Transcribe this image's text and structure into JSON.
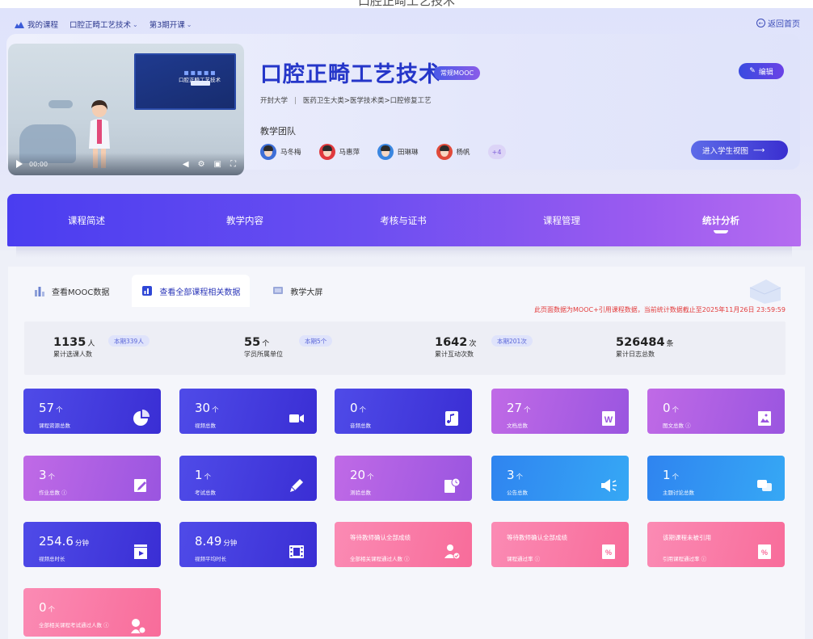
{
  "breadcrumb": {
    "my_courses": "我的课程",
    "course": "口腔正畸工艺技术",
    "term": "第3期开课"
  },
  "back_home": "返回首页",
  "video": {
    "screen_title_1": "■ ■ ■ ■ ■",
    "screen_title_2": "口腔正畸工艺技术",
    "time": "00:00"
  },
  "course": {
    "title": "口腔正畸工艺技术",
    "badge": "常规MOOC",
    "school": "开封大学",
    "category_path": "医药卫生大类>医学技术类>口腔修复工艺",
    "team_title": "教学团队",
    "team": [
      {
        "name": "马冬梅",
        "avatar_color": "#3e6fd8"
      },
      {
        "name": "马惠萍",
        "avatar_color": "#e0393e"
      },
      {
        "name": "田琳琳",
        "avatar_color": "#3a86e0"
      },
      {
        "name": "杨帆",
        "avatar_color": "#e04a3a"
      }
    ],
    "more_count": "+4"
  },
  "buttons": {
    "edit": "编辑",
    "student_view": "进入学生视图"
  },
  "nav_tabs": [
    {
      "label": "课程简述",
      "active": false
    },
    {
      "label": "教学内容",
      "active": false
    },
    {
      "label": "考核与证书",
      "active": false
    },
    {
      "label": "课程管理",
      "active": false
    },
    {
      "label": "统计分析",
      "active": true
    }
  ],
  "sub_tabs": [
    {
      "label": "查看MOOC数据",
      "active": false
    },
    {
      "label": "查看全部课程相关数据",
      "active": true
    },
    {
      "label": "教学大屏",
      "active": false
    }
  ],
  "notice": "此页面数据为MOOC+引用课程数据，当前统计数据截止至2025年11月26日 23:59:59",
  "summary": [
    {
      "value": "1135",
      "unit": "人",
      "label": "累计选课人数",
      "tag": "本期339人"
    },
    {
      "value": "55",
      "unit": "个",
      "label": "学员所属单位",
      "tag": "本期5个"
    },
    {
      "value": "1642",
      "unit": "次",
      "label": "累计互动次数",
      "tag": "本期201次"
    },
    {
      "value": "526484",
      "unit": "条",
      "label": "累计日志总数",
      "tag": ""
    }
  ],
  "cards": [
    {
      "value": "57",
      "unit": "个",
      "label": "课程资源总数",
      "icon": "pie-chart-icon"
    },
    {
      "value": "30",
      "unit": "个",
      "label": "视频总数",
      "icon": "video-camera-icon"
    },
    {
      "value": "0",
      "unit": "个",
      "label": "音频总数",
      "icon": "music-note-icon"
    },
    {
      "value": "27",
      "unit": "个",
      "label": "文档总数",
      "icon": "word-document-icon"
    },
    {
      "value": "0",
      "unit": "个",
      "label": "图文总数 ⓘ",
      "icon": "image-document-icon"
    },
    {
      "value": "3",
      "unit": "个",
      "label": "作业总数 ⓘ",
      "icon": "homework-edit-icon"
    },
    {
      "value": "1",
      "unit": "个",
      "label": "考试总数",
      "icon": "pen-icon"
    },
    {
      "value": "20",
      "unit": "个",
      "label": "测验总数",
      "icon": "quiz-timer-icon"
    },
    {
      "value": "3",
      "unit": "个",
      "label": "公告总数",
      "icon": "megaphone-icon"
    },
    {
      "value": "1",
      "unit": "个",
      "label": "主题讨论总数",
      "icon": "discussion-bubbles-icon"
    },
    {
      "value": "254.6",
      "unit": "分钟",
      "label": "视频总时长",
      "icon": "video-clapper-icon"
    },
    {
      "value": "8.49",
      "unit": "分钟",
      "label": "视频平均时长",
      "icon": "film-strip-icon"
    },
    {
      "pending": "等待教师确认全部成绩",
      "label": "全部相关课程通过人数 ⓘ",
      "icon": "user-check-icon"
    },
    {
      "pending": "等待教师确认全部成绩",
      "label": "课程通过率 ⓘ",
      "icon": "percent-doc-icon"
    },
    {
      "pending": "该期课程未被引用",
      "label": "引用课程通过率 ⓘ",
      "icon": "percent-doc-icon"
    },
    {
      "value": "0",
      "unit": "个",
      "label": "全部相关课程考试通过人数 ⓘ",
      "icon": "user-award-icon"
    }
  ],
  "colors": {
    "blue": "#3a2ed4",
    "purple": "#9a55e0",
    "skyblue": "#36a8f5",
    "pink": "#f86c9a",
    "notice": "#e33c3c"
  }
}
